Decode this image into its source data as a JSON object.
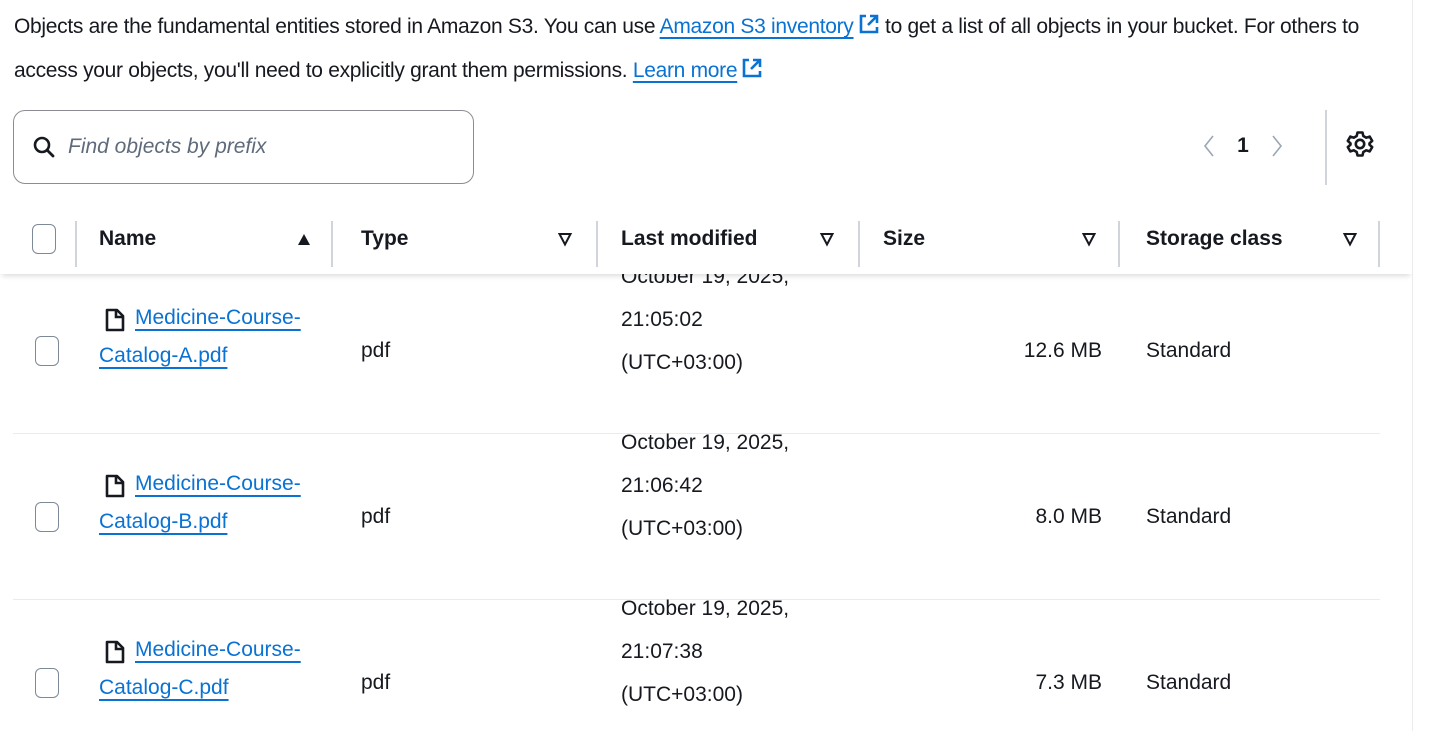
{
  "description": {
    "text1": "Objects are the fundamental entities stored in Amazon S3. You can use ",
    "link1": "Amazon S3 inventory",
    "text2": " to get a list of all objects in your bucket. For others to access your objects, you'll need to explicitly grant them permissions. ",
    "link2": "Learn more"
  },
  "search": {
    "placeholder": "Find objects by prefix",
    "value": ""
  },
  "pagination": {
    "current_page": "1"
  },
  "table": {
    "columns": {
      "name": "Name",
      "type": "Type",
      "last_modified": "Last modified",
      "size": "Size",
      "storage_class": "Storage class"
    },
    "rows": [
      {
        "name_line1": "Medicine-Course-",
        "name_line2": "Catalog-A.pdf",
        "type": "pdf",
        "modified_date": "October 19, 2025,",
        "modified_time": "21:05:02",
        "modified_tz": "(UTC+03:00)",
        "size": "12.6 MB",
        "storage_class": "Standard"
      },
      {
        "name_line1": "Medicine-Course-",
        "name_line2": "Catalog-B.pdf",
        "type": "pdf",
        "modified_date": "October 19, 2025,",
        "modified_time": "21:06:42",
        "modified_tz": "(UTC+03:00)",
        "size": "8.0 MB",
        "storage_class": "Standard"
      },
      {
        "name_line1": "Medicine-Course-",
        "name_line2": "Catalog-C.pdf",
        "type": "pdf",
        "modified_date": "October 19, 2025,",
        "modified_time": "21:07:38",
        "modified_tz": "(UTC+03:00)",
        "size": "7.3 MB",
        "storage_class": "Standard"
      }
    ]
  },
  "icons": {
    "search": "search-icon",
    "external": "external-link-icon",
    "settings": "gear-icon",
    "file": "file-icon",
    "sort_asc": "sort-ascending-icon",
    "sort_none": "sort-descending-icon"
  },
  "colors": {
    "link": "#0972d3",
    "text": "#16191f",
    "border": "#8c8c94"
  }
}
